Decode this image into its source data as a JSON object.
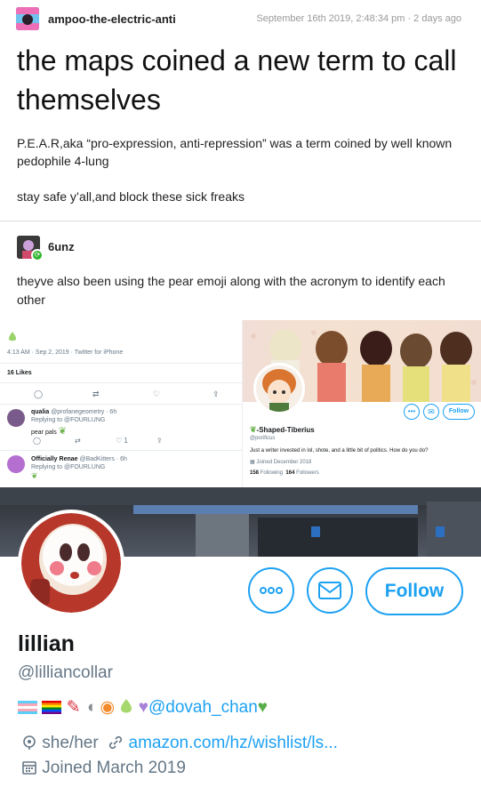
{
  "post": {
    "username": "ampoo-the-electric-anti",
    "timestamp": "September 16th 2019, 2:48:34 pm · 2 days ago",
    "title": "the maps coined a new term to call themselves",
    "paragraph1": "P.E.A.R,aka  “pro-expression, anti-repression”  was a term coined by well known pedophile 4-lung",
    "paragraph2": "stay safe y’all,and block these sick freaks"
  },
  "reblog": {
    "username": "6unz",
    "text": "theyve also been using the pear emoji along with the acronym to identify each other"
  },
  "embedded_left": {
    "tweet_meta": "4:13 AM · Sep 2, 2019 · Twitter for iPhone",
    "likes": "16 Likes",
    "reply1_name": "qualia",
    "reply1_handle": "@profanegeometry · 6h",
    "reply1_replying": "Replying to @FOURLUNG",
    "reply1_text": "pear pals",
    "reply1_likes": "1",
    "reply2_name": "Officially Renae",
    "reply2_handle": "@BadKitters · 6h",
    "reply2_replying": "Replying to @FOURLUNG"
  },
  "embedded_right": {
    "name": "-Shaped-Tiberius",
    "handle": "@porificus",
    "bio": "Just a writer invested in lol, shote, and a little bit of politics. How do you do?",
    "joined": "Joined December 2018",
    "following_count": "158",
    "following_label": "Following",
    "followers_count": "164",
    "followers_label": "Followers",
    "follow_label": "Follow"
  },
  "profile": {
    "name": "lillian",
    "handle": "@lilliancollar",
    "bio_mention": "@dovah_chan",
    "pronouns": "she/her",
    "link": "amazon.com/hz/wishlist/ls...",
    "joined": "Joined March 2019",
    "follow_label": "Follow"
  },
  "colors": {
    "twitter_blue": "#1da1f2",
    "reblog_green": "#2fb52f",
    "muted_text": "#657786"
  },
  "icons": [
    "user-avatar",
    "reblog-icon",
    "more-icon",
    "mail-icon",
    "location-icon",
    "link-icon",
    "calendar-icon",
    "pear-emoji",
    "heart-emoji"
  ]
}
